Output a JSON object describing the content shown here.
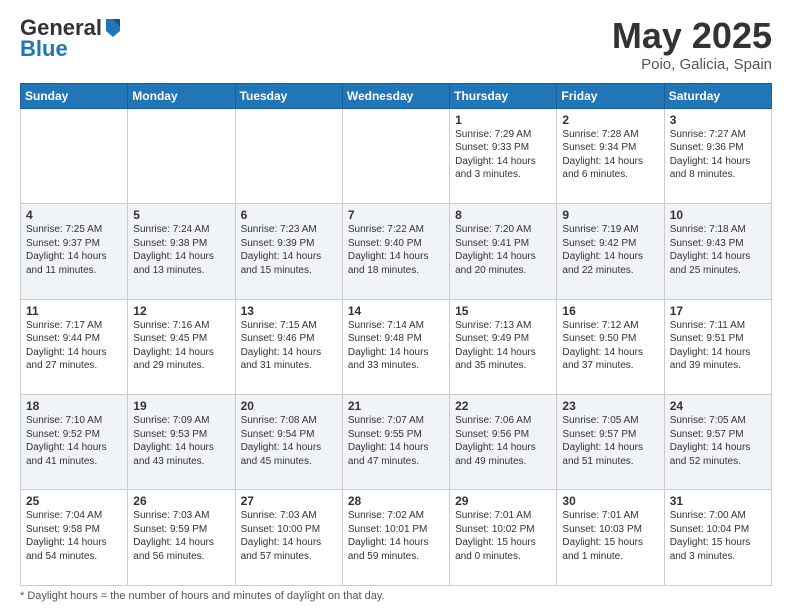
{
  "header": {
    "logo_general": "General",
    "logo_blue": "Blue",
    "title": "May 2025",
    "location": "Poio, Galicia, Spain"
  },
  "days_of_week": [
    "Sunday",
    "Monday",
    "Tuesday",
    "Wednesday",
    "Thursday",
    "Friday",
    "Saturday"
  ],
  "weeks": [
    [
      {
        "day": "",
        "info": ""
      },
      {
        "day": "",
        "info": ""
      },
      {
        "day": "",
        "info": ""
      },
      {
        "day": "",
        "info": ""
      },
      {
        "day": "1",
        "info": "Sunrise: 7:29 AM\nSunset: 9:33 PM\nDaylight: 14 hours\nand 3 minutes."
      },
      {
        "day": "2",
        "info": "Sunrise: 7:28 AM\nSunset: 9:34 PM\nDaylight: 14 hours\nand 6 minutes."
      },
      {
        "day": "3",
        "info": "Sunrise: 7:27 AM\nSunset: 9:36 PM\nDaylight: 14 hours\nand 8 minutes."
      }
    ],
    [
      {
        "day": "4",
        "info": "Sunrise: 7:25 AM\nSunset: 9:37 PM\nDaylight: 14 hours\nand 11 minutes."
      },
      {
        "day": "5",
        "info": "Sunrise: 7:24 AM\nSunset: 9:38 PM\nDaylight: 14 hours\nand 13 minutes."
      },
      {
        "day": "6",
        "info": "Sunrise: 7:23 AM\nSunset: 9:39 PM\nDaylight: 14 hours\nand 15 minutes."
      },
      {
        "day": "7",
        "info": "Sunrise: 7:22 AM\nSunset: 9:40 PM\nDaylight: 14 hours\nand 18 minutes."
      },
      {
        "day": "8",
        "info": "Sunrise: 7:20 AM\nSunset: 9:41 PM\nDaylight: 14 hours\nand 20 minutes."
      },
      {
        "day": "9",
        "info": "Sunrise: 7:19 AM\nSunset: 9:42 PM\nDaylight: 14 hours\nand 22 minutes."
      },
      {
        "day": "10",
        "info": "Sunrise: 7:18 AM\nSunset: 9:43 PM\nDaylight: 14 hours\nand 25 minutes."
      }
    ],
    [
      {
        "day": "11",
        "info": "Sunrise: 7:17 AM\nSunset: 9:44 PM\nDaylight: 14 hours\nand 27 minutes."
      },
      {
        "day": "12",
        "info": "Sunrise: 7:16 AM\nSunset: 9:45 PM\nDaylight: 14 hours\nand 29 minutes."
      },
      {
        "day": "13",
        "info": "Sunrise: 7:15 AM\nSunset: 9:46 PM\nDaylight: 14 hours\nand 31 minutes."
      },
      {
        "day": "14",
        "info": "Sunrise: 7:14 AM\nSunset: 9:48 PM\nDaylight: 14 hours\nand 33 minutes."
      },
      {
        "day": "15",
        "info": "Sunrise: 7:13 AM\nSunset: 9:49 PM\nDaylight: 14 hours\nand 35 minutes."
      },
      {
        "day": "16",
        "info": "Sunrise: 7:12 AM\nSunset: 9:50 PM\nDaylight: 14 hours\nand 37 minutes."
      },
      {
        "day": "17",
        "info": "Sunrise: 7:11 AM\nSunset: 9:51 PM\nDaylight: 14 hours\nand 39 minutes."
      }
    ],
    [
      {
        "day": "18",
        "info": "Sunrise: 7:10 AM\nSunset: 9:52 PM\nDaylight: 14 hours\nand 41 minutes."
      },
      {
        "day": "19",
        "info": "Sunrise: 7:09 AM\nSunset: 9:53 PM\nDaylight: 14 hours\nand 43 minutes."
      },
      {
        "day": "20",
        "info": "Sunrise: 7:08 AM\nSunset: 9:54 PM\nDaylight: 14 hours\nand 45 minutes."
      },
      {
        "day": "21",
        "info": "Sunrise: 7:07 AM\nSunset: 9:55 PM\nDaylight: 14 hours\nand 47 minutes."
      },
      {
        "day": "22",
        "info": "Sunrise: 7:06 AM\nSunset: 9:56 PM\nDaylight: 14 hours\nand 49 minutes."
      },
      {
        "day": "23",
        "info": "Sunrise: 7:05 AM\nSunset: 9:57 PM\nDaylight: 14 hours\nand 51 minutes."
      },
      {
        "day": "24",
        "info": "Sunrise: 7:05 AM\nSunset: 9:57 PM\nDaylight: 14 hours\nand 52 minutes."
      }
    ],
    [
      {
        "day": "25",
        "info": "Sunrise: 7:04 AM\nSunset: 9:58 PM\nDaylight: 14 hours\nand 54 minutes."
      },
      {
        "day": "26",
        "info": "Sunrise: 7:03 AM\nSunset: 9:59 PM\nDaylight: 14 hours\nand 56 minutes."
      },
      {
        "day": "27",
        "info": "Sunrise: 7:03 AM\nSunset: 10:00 PM\nDaylight: 14 hours\nand 57 minutes."
      },
      {
        "day": "28",
        "info": "Sunrise: 7:02 AM\nSunset: 10:01 PM\nDaylight: 14 hours\nand 59 minutes."
      },
      {
        "day": "29",
        "info": "Sunrise: 7:01 AM\nSunset: 10:02 PM\nDaylight: 15 hours\nand 0 minutes."
      },
      {
        "day": "30",
        "info": "Sunrise: 7:01 AM\nSunset: 10:03 PM\nDaylight: 15 hours\nand 1 minute."
      },
      {
        "day": "31",
        "info": "Sunrise: 7:00 AM\nSunset: 10:04 PM\nDaylight: 15 hours\nand 3 minutes."
      }
    ]
  ],
  "footer": "Daylight hours"
}
